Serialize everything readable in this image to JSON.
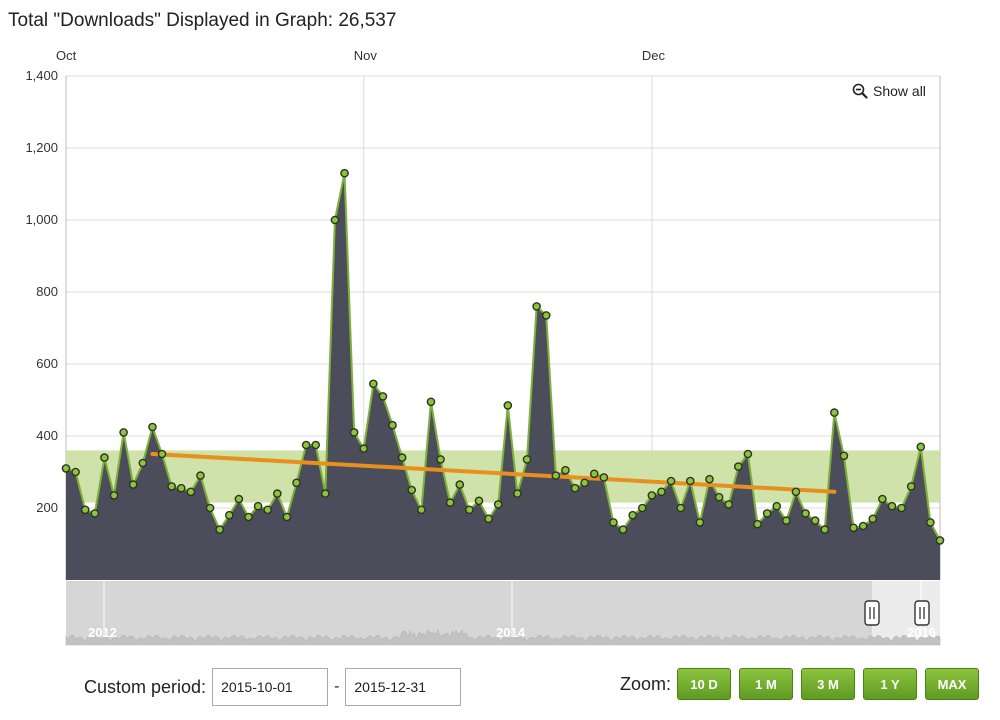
{
  "header": {
    "total_label": "Total \"Downloads\" Displayed in Graph: 26,537"
  },
  "controls": {
    "show_all": "Show all",
    "custom_period_label": "Custom period:",
    "date_from": "2015-10-01",
    "date_to": "2015-12-31",
    "date_separator": "-",
    "zoom_label": "Zoom:",
    "zoom_buttons": [
      "10 D",
      "1 M",
      "3 M",
      "1 Y",
      "MAX"
    ]
  },
  "navigator": {
    "labels": [
      "2012",
      "2014",
      "2016"
    ],
    "selected_range": [
      "2015-10-01",
      "2015-12-31"
    ]
  },
  "colors": {
    "area_fill": "#4b4d5a",
    "series_line": "#7fb03a",
    "marker_fill": "#8cc43f",
    "trend_line": "#e8901e",
    "band": "#c9dfa0",
    "grid": "#dcdcdc",
    "navigator_bg": "#d6d6d6",
    "navigator_selection": "#ececec",
    "zoom_button": "#7cb232"
  },
  "chart_data": {
    "type": "area",
    "ylim": [
      0,
      1400
    ],
    "yticks": [
      200,
      400,
      600,
      800,
      1000,
      1200,
      1400
    ],
    "ytick_labels": [
      "200",
      "400",
      "600",
      "800",
      "1,000",
      "1,200",
      "1,400"
    ],
    "xlim": [
      "2015-10-01",
      "2015-12-31"
    ],
    "month_labels": [
      {
        "label": "Oct",
        "date": "2015-10-01"
      },
      {
        "label": "Nov",
        "date": "2015-11-01"
      },
      {
        "label": "Dec",
        "date": "2015-12-01"
      }
    ],
    "start_date": "2015-10-01",
    "values": [
      310,
      300,
      195,
      185,
      340,
      235,
      410,
      265,
      325,
      425,
      350,
      260,
      255,
      245,
      290,
      200,
      140,
      180,
      225,
      175,
      205,
      195,
      240,
      175,
      270,
      375,
      375,
      240,
      1000,
      1130,
      410,
      365,
      545,
      510,
      430,
      340,
      250,
      195,
      495,
      335,
      215,
      265,
      195,
      220,
      170,
      210,
      485,
      240,
      335,
      760,
      735,
      290,
      305,
      255,
      270,
      295,
      285,
      160,
      140,
      180,
      200,
      235,
      245,
      275,
      200,
      275,
      160,
      280,
      230,
      210,
      315,
      350,
      155,
      185,
      205,
      165,
      245,
      185,
      165,
      140,
      465,
      345,
      145,
      150,
      170,
      225,
      205,
      200,
      260,
      370,
      160,
      110
    ],
    "trend": {
      "from": [
        "2015-10-10",
        350
      ],
      "to": [
        "2015-12-20",
        245
      ]
    },
    "band": [
      215,
      360
    ],
    "grid": true
  }
}
